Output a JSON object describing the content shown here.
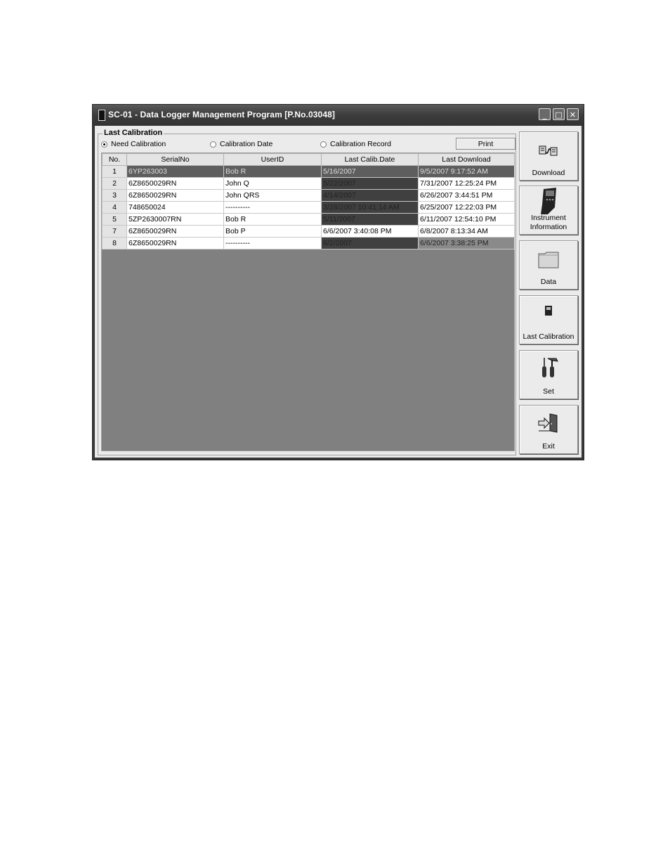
{
  "window": {
    "title": "SC-01 - Data Logger Management Program [P.No.03048]",
    "controls": {
      "minimize": "_",
      "maximize": "□",
      "close": "✕"
    }
  },
  "panel": {
    "group_label": "Last Calibration",
    "radios": [
      {
        "label": "Need Calibration",
        "selected": true
      },
      {
        "label": "Calibration Date",
        "selected": false
      },
      {
        "label": "Calibration Record",
        "selected": false
      }
    ],
    "print_label": "Print"
  },
  "table": {
    "columns": [
      "No.",
      "SerialNo",
      "UserID",
      "Last Calib.Date",
      "Last Download"
    ],
    "rows": [
      {
        "no": "1",
        "serial": "6YP263003",
        "user": "Bob R",
        "calib": "5/16/2007",
        "download": "9/5/2007 9:17:52 AM"
      },
      {
        "no": "2",
        "serial": "6Z8650029RN",
        "user": "John Q",
        "calib": "5/22/2007",
        "download": "7/31/2007 12:25:24 PM"
      },
      {
        "no": "3",
        "serial": "6Z8650029RN",
        "user": "John QRS",
        "calib": "4/14/2007",
        "download": "6/26/2007 3:44:51 PM"
      },
      {
        "no": "4",
        "serial": "748650024",
        "user": "----------",
        "calib": "3/28/2007 10:41:14 AM",
        "download": "6/25/2007 12:22:03 PM"
      },
      {
        "no": "5",
        "serial": "5ZP2630007RN",
        "user": "Bob R",
        "calib": "5/11/2007",
        "download": "6/11/2007 12:54:10 PM"
      },
      {
        "no": "7",
        "serial": "6Z8650029RN",
        "user": "Bob P",
        "calib": "6/6/2007 3:40:08 PM",
        "download": "6/8/2007 8:13:34 AM"
      },
      {
        "no": "8",
        "serial": "6Z8650029RN",
        "user": "----------",
        "calib": "6/2/2007",
        "download": "6/6/2007 3:38:25 PM"
      }
    ]
  },
  "sidebar": {
    "buttons": [
      {
        "label": "Download",
        "icon": "download-icon"
      },
      {
        "label": "Instrument Information",
        "icon": "instrument-icon"
      },
      {
        "label": "Data",
        "icon": "folder-icon"
      },
      {
        "label": "Last Calibration",
        "icon": "calibration-icon"
      },
      {
        "label": "Set",
        "icon": "tools-icon"
      },
      {
        "label": "Exit",
        "icon": "exit-door-icon"
      }
    ]
  }
}
